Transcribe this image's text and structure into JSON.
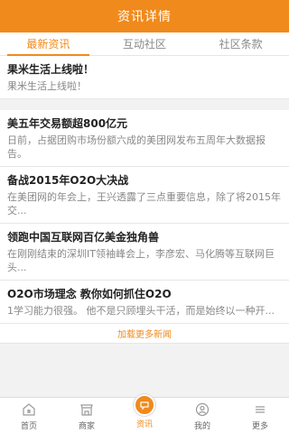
{
  "header": {
    "title": "资讯详情"
  },
  "tabs": [
    {
      "label": "最新资讯"
    },
    {
      "label": "互动社区"
    },
    {
      "label": "社区条款"
    }
  ],
  "news": [
    {
      "title": "果米生活上线啦！",
      "summary": "果米生活上线啦！"
    },
    {
      "title": "美五年交易额超800亿元",
      "summary": "日前，占据团购市场份额六成的美团网发布五周年大数据报告。"
    },
    {
      "title": "备战2015年O2O大决战",
      "summary": "在美团网的年会上，王兴透露了三点重要信息，除了将2015年交..."
    },
    {
      "title": "领跑中国互联网百亿美金独角兽",
      "summary": "在刚刚结束的深圳IT领袖峰会上，李彦宏、马化腾等互联网巨头..."
    },
    {
      "title": "O2O市场理念 教你如何抓住O2O",
      "summary": "1学习能力很强。 他不是只顾埋头干活，而是始终以一种开..."
    }
  ],
  "load_more": "加载更多新闻",
  "bottom_nav": [
    {
      "label": "首页",
      "icon": "home-icon"
    },
    {
      "label": "商家",
      "icon": "store-icon"
    },
    {
      "label": "资讯",
      "icon": "news-icon"
    },
    {
      "label": "我的",
      "icon": "user-icon"
    },
    {
      "label": "更多",
      "icon": "more-icon"
    }
  ],
  "colors": {
    "accent": "#f08a1c",
    "background": "#f2f2f2"
  }
}
